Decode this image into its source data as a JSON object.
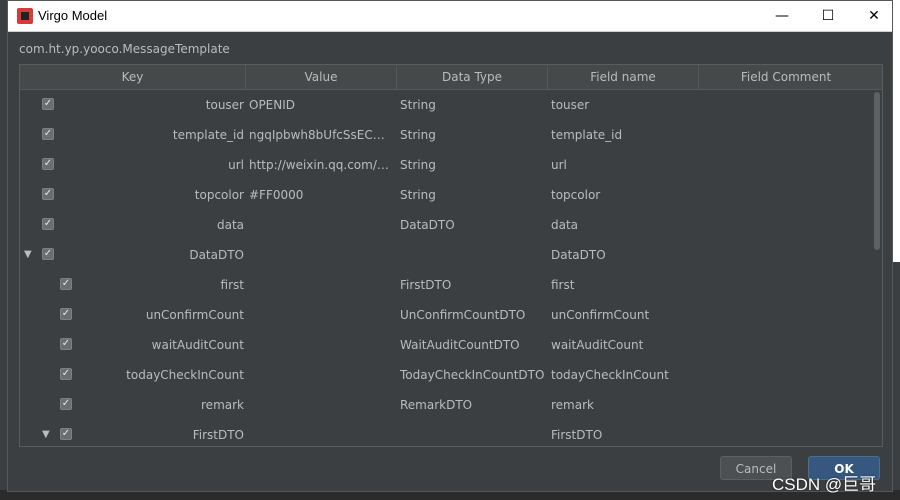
{
  "window": {
    "title": "Virgo Model",
    "controls": {
      "minimize": "—",
      "maximize": "☐",
      "close": "✕"
    }
  },
  "class_name": "com.ht.yp.yooco.MessageTemplate",
  "table": {
    "columns": [
      "Key",
      "Value",
      "Data Type",
      "Field name",
      "Field Comment"
    ],
    "rows": [
      {
        "key": "touser",
        "value": "OPENID",
        "data_type": "String",
        "field_name": "touser",
        "field_comment": "",
        "checked": true,
        "depth": 0
      },
      {
        "key": "template_id",
        "value": "ngqIpbwh8bUfcSsECm...",
        "data_type": "String",
        "field_name": "template_id",
        "field_comment": "",
        "checked": true,
        "depth": 0
      },
      {
        "key": "url",
        "value": "http://weixin.qq.com/d...",
        "data_type": "String",
        "field_name": "url",
        "field_comment": "",
        "checked": true,
        "depth": 0
      },
      {
        "key": "topcolor",
        "value": "#FF0000",
        "data_type": "String",
        "field_name": "topcolor",
        "field_comment": "",
        "checked": true,
        "depth": 0
      },
      {
        "key": "data",
        "value": "",
        "data_type": "DataDTO",
        "field_name": "data",
        "field_comment": "",
        "checked": true,
        "depth": 0
      },
      {
        "key": "DataDTO",
        "value": "",
        "data_type": "",
        "field_name": "DataDTO",
        "field_comment": "",
        "checked": true,
        "depth": 0,
        "expandable": true
      },
      {
        "key": "first",
        "value": "",
        "data_type": "FirstDTO",
        "field_name": "first",
        "field_comment": "",
        "checked": true,
        "depth": 1
      },
      {
        "key": "unConfirmCount",
        "value": "",
        "data_type": "UnConfirmCountDTO",
        "field_name": "unConfirmCount",
        "field_comment": "",
        "checked": true,
        "depth": 1
      },
      {
        "key": "waitAuditCount",
        "value": "",
        "data_type": "WaitAuditCountDTO",
        "field_name": "waitAuditCount",
        "field_comment": "",
        "checked": true,
        "depth": 1
      },
      {
        "key": "todayCheckInCount",
        "value": "",
        "data_type": "TodayCheckInCountDTO",
        "field_name": "todayCheckInCount",
        "field_comment": "",
        "checked": true,
        "depth": 1
      },
      {
        "key": "remark",
        "value": "",
        "data_type": "RemarkDTO",
        "field_name": "remark",
        "field_comment": "",
        "checked": true,
        "depth": 1
      },
      {
        "key": "FirstDTO",
        "value": "",
        "data_type": "",
        "field_name": "FirstDTO",
        "field_comment": "",
        "checked": true,
        "depth": 1,
        "expandable": true
      }
    ]
  },
  "buttons": {
    "cancel": "Cancel",
    "ok": "OK"
  },
  "watermark": "CSDN @巨哥",
  "colors": {
    "background": "#3c3f41",
    "text": "#bbbbbb",
    "accent": "#365880"
  }
}
